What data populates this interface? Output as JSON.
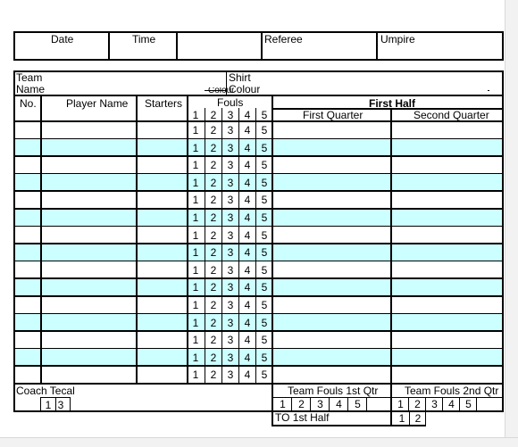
{
  "header": {
    "date_label": "Date",
    "time_label": "Time",
    "blank_label": "",
    "referee_label": "Referee",
    "umpire_label": "Umpire"
  },
  "team": {
    "team_name_label_1": "Team",
    "team_name_label_2": "Name",
    "shirt_label_1": "Shirt",
    "shirt_label_2": "Colour"
  },
  "columns": {
    "no": "No.",
    "player_name": "Player Name",
    "starters": "Starters",
    "fouls": "Fouls",
    "foul_numbers": [
      "1",
      "2",
      "3",
      "4",
      "5"
    ],
    "first_half": "First Half",
    "first_quarter": "First Quarter",
    "second_quarter": "Second Quarter"
  },
  "rows": [
    {
      "shaded": false
    },
    {
      "shaded": true
    },
    {
      "shaded": false
    },
    {
      "shaded": true
    },
    {
      "shaded": false
    },
    {
      "shaded": true
    },
    {
      "shaded": false
    },
    {
      "shaded": true
    },
    {
      "shaded": false
    },
    {
      "shaded": true
    },
    {
      "shaded": false
    },
    {
      "shaded": true
    },
    {
      "shaded": false
    },
    {
      "shaded": true
    },
    {
      "shaded": false
    }
  ],
  "footer": {
    "coach_label": "Coach Tecal",
    "coach_boxes": [
      "1",
      "3"
    ],
    "team_fouls_1st": "Team Fouls 1st Qtr",
    "team_fouls_2nd": "Team Fouls 2nd Qtr",
    "team_foul_numbers": [
      "1",
      "2",
      "3",
      "4",
      "5"
    ],
    "to_label": "TO 1st Half",
    "to_boxes": [
      "1",
      "2"
    ]
  },
  "colors": {
    "shade": "#ccffff",
    "lines": "#000000"
  }
}
